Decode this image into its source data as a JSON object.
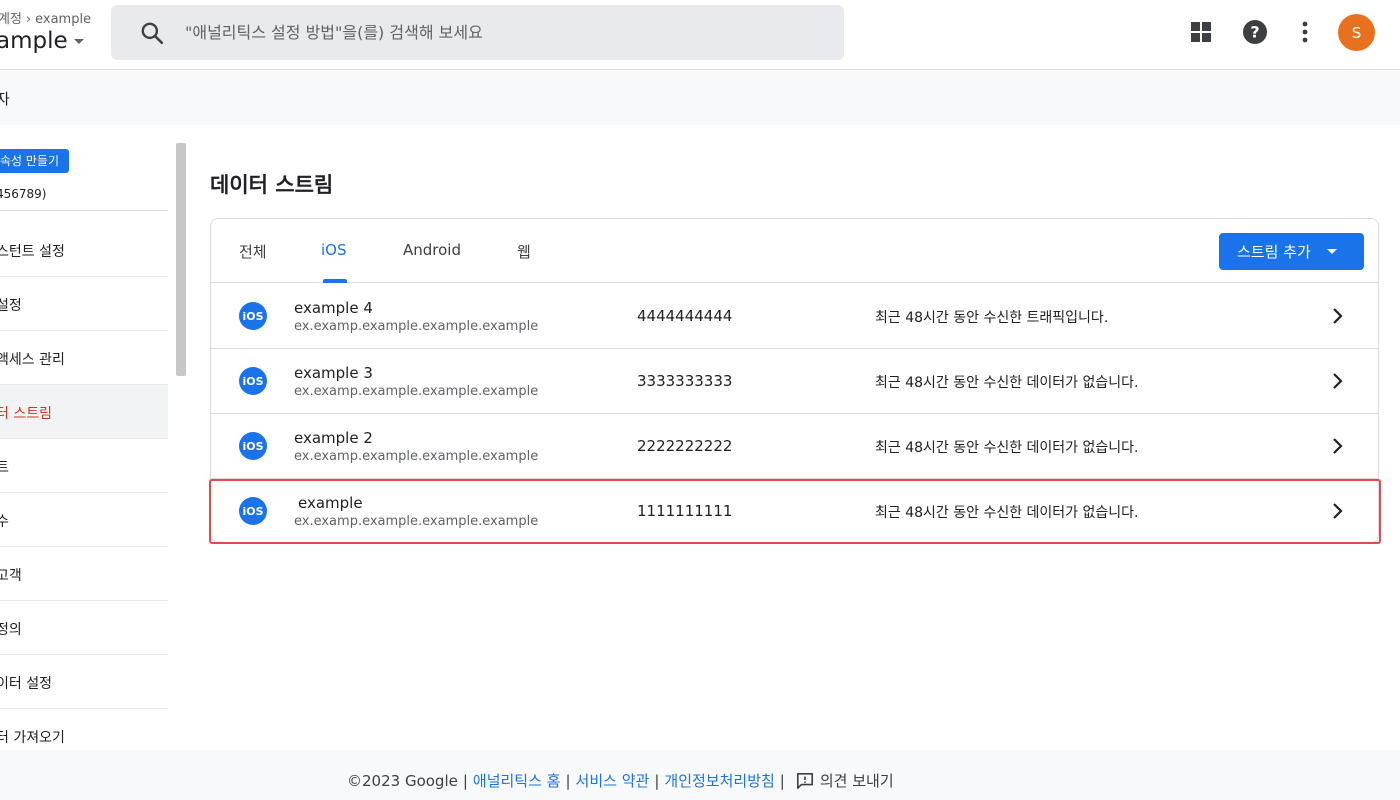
{
  "header": {
    "breadcrumb_account": "계정",
    "breadcrumb_name": "example",
    "property_name": "ample",
    "search_placeholder": "\"애널리틱스 설정 방법\"을(를) 검색해 보세요",
    "avatar_letter": "S",
    "icons": [
      "apps-icon",
      "help-icon",
      "more-vert-icon"
    ]
  },
  "admin": {
    "label": "자"
  },
  "sidebar": {
    "create_button": "속성 만들기",
    "property_id": "456789)",
    "items": [
      {
        "label": "스턴트 설정"
      },
      {
        "label": "설정"
      },
      {
        "label": "액세스 관리"
      },
      {
        "label": "터 스트림",
        "active": true
      },
      {
        "label": "트"
      },
      {
        "label": "수"
      },
      {
        "label": "고객"
      },
      {
        "label": "정의"
      },
      {
        "label": "이터 설정"
      },
      {
        "label": "터 가져오기"
      }
    ]
  },
  "main": {
    "title": "데이터 스트림",
    "tabs": [
      {
        "label": "전체"
      },
      {
        "label": "iOS",
        "active": true
      },
      {
        "label": "Android"
      },
      {
        "label": "웹"
      }
    ],
    "add_button": "스트림 추가",
    "streams": [
      {
        "platform": "iOS",
        "name": "example 4",
        "bundle": "ex.examp.example.example.example",
        "id": "4444444444",
        "status": "최근 48시간 동안 수신한 트래픽입니다."
      },
      {
        "platform": "iOS",
        "name": "example 3",
        "bundle": "ex.examp.example.example.example",
        "id": "3333333333",
        "status": "최근 48시간 동안 수신한 데이터가 없습니다."
      },
      {
        "platform": "iOS",
        "name": "example 2",
        "bundle": "ex.examp.example.example.example",
        "id": "2222222222",
        "status": "최근 48시간 동안 수신한 데이터가 없습니다."
      },
      {
        "platform": "iOS",
        "name": "example",
        "bundle": "ex.examp.example.example.example",
        "id": "1111111111",
        "status": "최근 48시간 동안 수신한 데이터가 없습니다.",
        "highlighted": true
      }
    ],
    "badge_text": "iOS"
  },
  "footer": {
    "copyright": "©2023 Google",
    "links": [
      "애널리틱스 홈",
      "서비스 약관",
      "개인정보처리방침"
    ],
    "feedback": "의견 보내기"
  },
  "colors": {
    "accent": "#1a73e8",
    "active_nav": "#d93025",
    "avatar": "#e8711f",
    "highlight": "#e5484d"
  }
}
